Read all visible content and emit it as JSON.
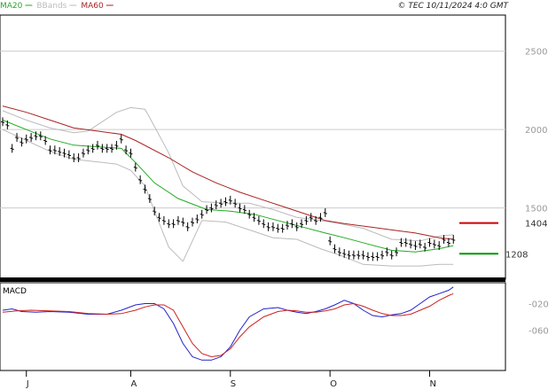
{
  "header": {
    "legend": [
      {
        "label": "MA20",
        "color": "#22aa22"
      },
      {
        "label": "BBands",
        "color": "#bbbbbb"
      },
      {
        "label": "MA60",
        "color": "#aa2222"
      }
    ],
    "copyright": "© TEC 10/11/2024 4:0 GMT"
  },
  "chart_data": [
    {
      "type": "line",
      "title": "",
      "y_ticks": [
        "2500",
        "2000",
        "1500"
      ],
      "ylim": [
        1000,
        2600
      ],
      "x_ticks": [
        "J",
        "A",
        "S",
        "O",
        "N"
      ],
      "x_tick_index": [
        5,
        27,
        48,
        69,
        90
      ],
      "n_bars": 96,
      "grid": true,
      "price_levels": [
        {
          "label": "1404",
          "value": 1404,
          "color": "#cc0000"
        },
        {
          "label": "1208",
          "value": 1208,
          "color": "#009900"
        }
      ],
      "price": [
        2050,
        2030,
        1880,
        1950,
        1920,
        1940,
        1950,
        1960,
        1960,
        1930,
        1870,
        1870,
        1860,
        1850,
        1840,
        1820,
        1820,
        1850,
        1870,
        1880,
        1900,
        1880,
        1880,
        1880,
        1900,
        1940,
        1870,
        1850,
        1760,
        1680,
        1620,
        1560,
        1480,
        1440,
        1420,
        1400,
        1400,
        1420,
        1410,
        1380,
        1410,
        1430,
        1460,
        1490,
        1500,
        1520,
        1530,
        1540,
        1550,
        1530,
        1500,
        1490,
        1460,
        1440,
        1420,
        1400,
        1380,
        1380,
        1370,
        1370,
        1390,
        1400,
        1380,
        1400,
        1420,
        1440,
        1420,
        1440,
        1470,
        1290,
        1240,
        1220,
        1210,
        1200,
        1200,
        1200,
        1200,
        1190,
        1190,
        1190,
        1200,
        1220,
        1200,
        1220,
        1280,
        1280,
        1270,
        1260,
        1270,
        1250,
        1280,
        1270,
        1260,
        1300,
        1280,
        1300
      ],
      "series": [
        {
          "name": "MA20",
          "color": "#22aa22",
          "x": [
            0,
            5,
            10,
            15,
            20,
            25,
            28,
            32,
            37,
            43,
            48,
            53,
            58,
            63,
            68,
            72,
            77,
            82,
            87,
            92,
            95
          ],
          "y": [
            2060,
            2000,
            1940,
            1900,
            1890,
            1880,
            1790,
            1660,
            1560,
            1490,
            1480,
            1460,
            1420,
            1380,
            1340,
            1310,
            1270,
            1230,
            1220,
            1240,
            1260
          ]
        },
        {
          "name": "BBands",
          "color": "#bbbbbb",
          "x": [
            0,
            5,
            10,
            15,
            18,
            21,
            24,
            27,
            30,
            32,
            35,
            38,
            42,
            47,
            52,
            57,
            62,
            67,
            71,
            76,
            82,
            88,
            92,
            95
          ],
          "y": [
            2120,
            2060,
            2010,
            1980,
            1990,
            2050,
            2110,
            2140,
            2130,
            2020,
            1850,
            1640,
            1540,
            1530,
            1530,
            1490,
            1440,
            1420,
            1400,
            1370,
            1300,
            1290,
            1320,
            1330
          ]
        },
        {
          "name": "BBands",
          "color": "#bbbbbb",
          "x": [
            0,
            5,
            10,
            15,
            18,
            21,
            24,
            27,
            30,
            32,
            35,
            38,
            42,
            47,
            52,
            57,
            62,
            67,
            71,
            76,
            82,
            88,
            92,
            95
          ],
          "y": [
            2000,
            1930,
            1860,
            1810,
            1800,
            1790,
            1780,
            1740,
            1640,
            1480,
            1250,
            1160,
            1420,
            1410,
            1360,
            1310,
            1300,
            1240,
            1200,
            1140,
            1130,
            1130,
            1140,
            1140
          ]
        },
        {
          "name": "MA60",
          "color": "#aa2222",
          "x": [
            0,
            5,
            10,
            15,
            20,
            25,
            28,
            35,
            40,
            45,
            50,
            55,
            60,
            65,
            68,
            72,
            77,
            82,
            87,
            92,
            95
          ],
          "y": [
            2150,
            2110,
            2060,
            2010,
            1990,
            1970,
            1930,
            1820,
            1730,
            1660,
            1600,
            1550,
            1500,
            1450,
            1420,
            1400,
            1380,
            1360,
            1340,
            1310,
            1300
          ]
        }
      ]
    },
    {
      "type": "line",
      "title": "MACD",
      "y_ticks": [
        "-020",
        "-060"
      ],
      "ylim": [
        -110,
        10
      ],
      "series": [
        {
          "name": "",
          "color": "#2222cc",
          "x": [
            0,
            2,
            4,
            7,
            10,
            14,
            18,
            22,
            25,
            28,
            30,
            32,
            34,
            36,
            38,
            40,
            42,
            44,
            46,
            48,
            50,
            52,
            55,
            58,
            60,
            62,
            64,
            66,
            68,
            70,
            72,
            74,
            76,
            78,
            80,
            82,
            84,
            86,
            88,
            90,
            92,
            94,
            95
          ],
          "y": [
            -30,
            -28,
            -32,
            -33,
            -32,
            -33,
            -36,
            -36,
            -30,
            -22,
            -20,
            -20,
            -28,
            -50,
            -80,
            -100,
            -105,
            -105,
            -100,
            -85,
            -60,
            -40,
            -28,
            -26,
            -30,
            -33,
            -35,
            -32,
            -28,
            -22,
            -15,
            -20,
            -30,
            -38,
            -40,
            -37,
            -35,
            -30,
            -20,
            -10,
            -5,
            0,
            5
          ]
        },
        {
          "name": "",
          "color": "#cc2222",
          "x": [
            0,
            3,
            6,
            10,
            14,
            18,
            22,
            25,
            28,
            30,
            32,
            34,
            36,
            38,
            40,
            42,
            44,
            46,
            48,
            50,
            52,
            55,
            58,
            60,
            62,
            64,
            66,
            68,
            70,
            72,
            74,
            76,
            78,
            80,
            82,
            84,
            86,
            88,
            90,
            92,
            94,
            95
          ],
          "y": [
            -33,
            -31,
            -30,
            -31,
            -32,
            -35,
            -36,
            -35,
            -30,
            -25,
            -22,
            -22,
            -30,
            -55,
            -80,
            -95,
            -100,
            -98,
            -88,
            -70,
            -55,
            -40,
            -32,
            -30,
            -31,
            -33,
            -33,
            -31,
            -28,
            -22,
            -20,
            -24,
            -30,
            -35,
            -38,
            -38,
            -36,
            -30,
            -24,
            -15,
            -8,
            -5
          ]
        }
      ]
    }
  ]
}
